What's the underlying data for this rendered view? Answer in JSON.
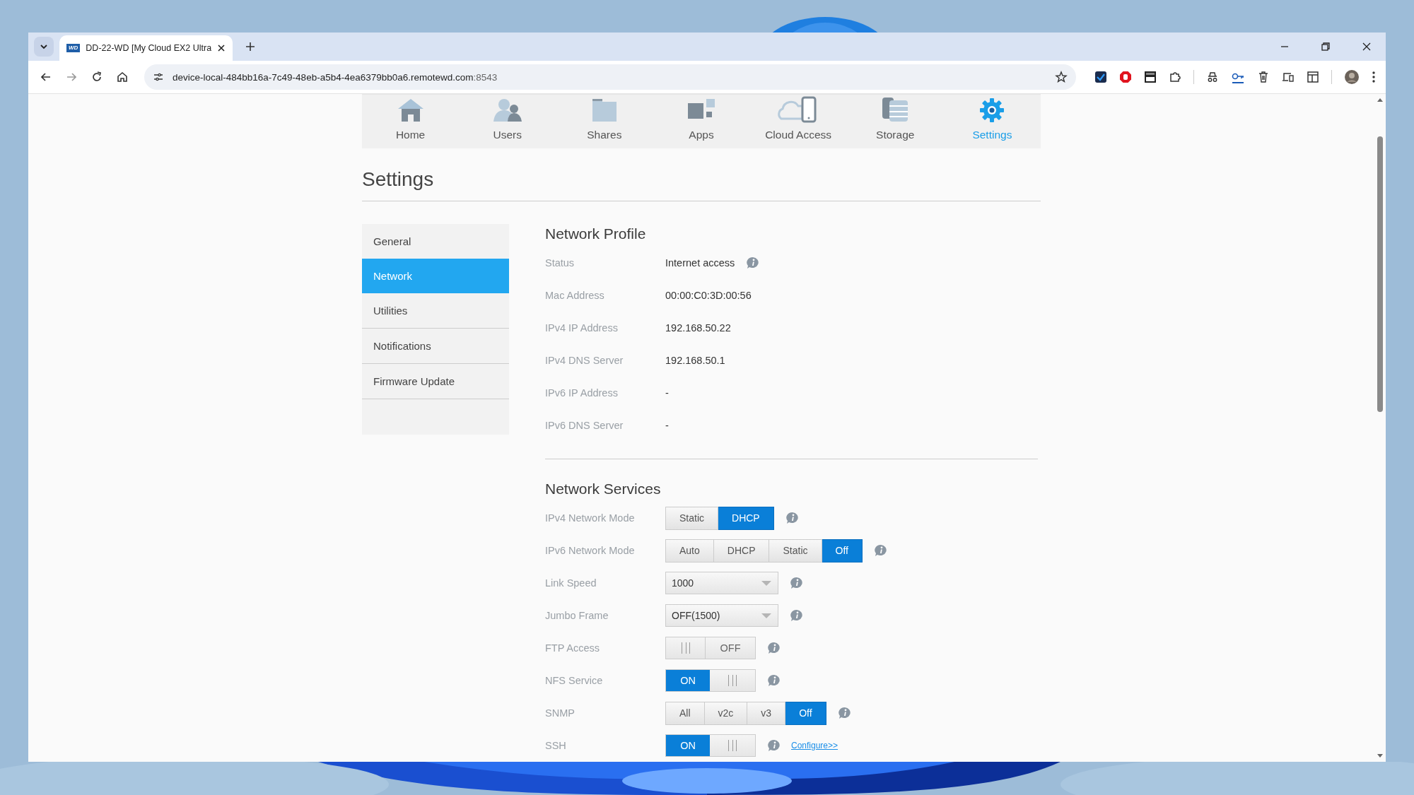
{
  "browser": {
    "tab": {
      "favicon": "WD",
      "title": "DD-22-WD [My Cloud EX2 Ultra"
    },
    "url": {
      "host": "device-local-484bb16a-7c49-48eb-a5b4-4ea6379bb0a6.remotewd.com",
      "port": ":8543"
    }
  },
  "nav": [
    {
      "label": "Home",
      "selected": false
    },
    {
      "label": "Users",
      "selected": false
    },
    {
      "label": "Shares",
      "selected": false
    },
    {
      "label": "Apps",
      "selected": false
    },
    {
      "label": "Cloud Access",
      "selected": false
    },
    {
      "label": "Storage",
      "selected": false
    },
    {
      "label": "Settings",
      "selected": true
    }
  ],
  "page_title": "Settings",
  "sidebar": [
    {
      "label": "General",
      "selected": false
    },
    {
      "label": "Network",
      "selected": true
    },
    {
      "label": "Utilities",
      "selected": false
    },
    {
      "label": "Notifications",
      "selected": false
    },
    {
      "label": "Firmware Update",
      "selected": false
    }
  ],
  "network_profile": {
    "title": "Network Profile",
    "rows": [
      {
        "label": "Status",
        "value": "Internet access",
        "info": true
      },
      {
        "label": "Mac Address",
        "value": "00:00:C0:3D:00:56",
        "info": false
      },
      {
        "label": "IPv4 IP Address",
        "value": "192.168.50.22",
        "info": false
      },
      {
        "label": "IPv4 DNS Server",
        "value": "192.168.50.1",
        "info": false
      },
      {
        "label": "IPv6 IP Address",
        "value": "-",
        "info": false
      },
      {
        "label": "IPv6 DNS Server",
        "value": "-",
        "info": false
      }
    ]
  },
  "network_services": {
    "title": "Network Services",
    "rows": [
      {
        "label": "IPv4 Network Mode",
        "kind": "segmented",
        "options": [
          {
            "label": "Static",
            "selected": false
          },
          {
            "label": "DHCP",
            "selected": true
          }
        ]
      },
      {
        "label": "IPv6 Network Mode",
        "kind": "segmented",
        "options": [
          {
            "label": "Auto",
            "selected": false
          },
          {
            "label": "DHCP",
            "selected": false
          },
          {
            "label": "Static",
            "selected": false
          },
          {
            "label": "Off",
            "selected": true
          }
        ]
      },
      {
        "label": "Link Speed",
        "kind": "select",
        "value": "1000"
      },
      {
        "label": "Jumbo Frame",
        "kind": "select",
        "value": "OFF(1500)"
      },
      {
        "label": "FTP Access",
        "kind": "toggle",
        "on": false,
        "text": "OFF"
      },
      {
        "label": "NFS Service",
        "kind": "toggle",
        "on": true,
        "text": "ON"
      },
      {
        "label": "SNMP",
        "kind": "segmented",
        "options": [
          {
            "label": "All",
            "selected": false
          },
          {
            "label": "v2c",
            "selected": false
          },
          {
            "label": "v3",
            "selected": false
          },
          {
            "label": "Off",
            "selected": true
          }
        ]
      },
      {
        "label": "SSH",
        "kind": "toggle",
        "on": true,
        "text": "ON",
        "link": "Configure>>"
      }
    ]
  }
}
